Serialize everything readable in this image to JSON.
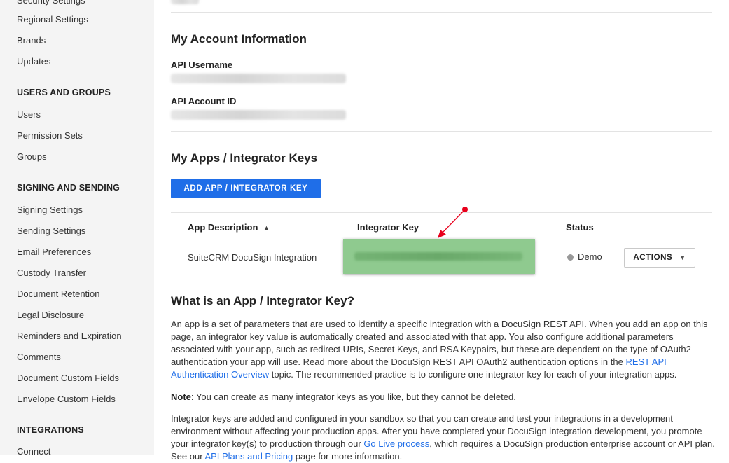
{
  "sidebar": {
    "top_items": [
      "Security Settings",
      "Regional Settings",
      "Brands",
      "Updates"
    ],
    "sections": [
      {
        "heading": "USERS AND GROUPS",
        "items": [
          "Users",
          "Permission Sets",
          "Groups"
        ]
      },
      {
        "heading": "SIGNING AND SENDING",
        "items": [
          "Signing Settings",
          "Sending Settings",
          "Email Preferences",
          "Custody Transfer",
          "Document Retention",
          "Legal Disclosure",
          "Reminders and Expiration",
          "Comments",
          "Document Custom Fields",
          "Envelope Custom Fields"
        ]
      },
      {
        "heading": "INTEGRATIONS",
        "items": [
          "Connect"
        ]
      }
    ]
  },
  "account": {
    "title": "My Account Information",
    "api_username_label": "API Username",
    "api_account_id_label": "API Account ID"
  },
  "apps": {
    "title": "My Apps / Integrator Keys",
    "add_button": "ADD APP / INTEGRATOR KEY",
    "table": {
      "headers": {
        "description": "App Description",
        "sort_indicator": "▲",
        "key": "Integrator Key",
        "status": "Status"
      },
      "rows": [
        {
          "description": "SuiteCRM DocuSign Integration",
          "status": "Demo",
          "actions": "ACTIONS",
          "actions_caret": "▼"
        }
      ]
    }
  },
  "info": {
    "title": "What is an App / Integrator Key?",
    "p1_text": "An app is a set of parameters that are used to identify a specific integration with a DocuSign REST API. When you add an app on this page, an integrator key value is automatically created and associated with that app. You also configure additional parameters associated with your app, such as redirect URIs, Secret Keys, and RSA Keypairs, but these are dependent on the type of OAuth2 authentication your app will use. Read more about the DocuSign REST API OAuth2 authentication options in the ",
    "p1_link": "REST API Authentication Overview",
    "p1_tail": " topic. The recommended practice is to configure one integrator key for each of your integration apps.",
    "note_label": "Note",
    "note_text": ": You can create as many integrator keys as you like, but they cannot be deleted.",
    "p3_text": "Integrator keys are added and configured in your sandbox so that you can create and test your integrations in a development environment without affecting your production apps. After you have completed your DocuSign integration development, you promote your integrator key(s) to production through our ",
    "p3_link": "Go Live process",
    "p3_tail": ", which requires a DocuSign production enterprise account or API plan. See our ",
    "p3_link2": "API Plans and Pricing",
    "p3_tail2": " page for more information."
  },
  "colors": {
    "primary": "#1f6ee8",
    "annotation": "#e8001c",
    "key_highlight": "#8fca8f",
    "sidebar_bg": "#f4f4f4"
  }
}
